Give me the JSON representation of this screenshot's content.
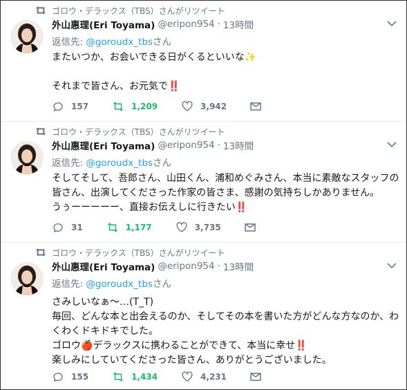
{
  "colors": {
    "name": "#14171a",
    "muted": "#657786",
    "link": "#1da1f2",
    "retweeted": "#17bf63",
    "divider": "#e6ecf0"
  },
  "tweets": [
    {
      "retweet_label": "ゴロウ・デラックス（TBS）さんがリツイート",
      "name": "外山惠理(Eri Toyama)",
      "handle": "@eripon954",
      "dot": "·",
      "time": "13時間",
      "reply_prefix": "返信先: ",
      "reply_to": "@goroudx_tbs",
      "reply_suffix": "さん",
      "lines": [
        "またいつか、お会いできる日がくるといいな✨",
        "",
        "それまで皆さん、お元気で‼️"
      ],
      "replies": "157",
      "retweets": "1,209",
      "likes": "3,942"
    },
    {
      "retweet_label": "ゴロウ・デラックス（TBS）さんがリツイート",
      "name": "外山惠理(Eri Toyama)",
      "handle": "@eripon954",
      "dot": "·",
      "time": "13時間",
      "reply_prefix": "返信先: ",
      "reply_to": "@goroudx_tbs",
      "reply_suffix": "さん",
      "lines": [
        "そしてそして、吾郎さん、山田くん、浦和めぐみさん、本当に素敵なスタッフの",
        "皆さん、出演してくださった作家の皆さま、感謝の気持ちしかありません。",
        "うぅーーーーー、直接お伝えしに行きたい‼️"
      ],
      "replies": "31",
      "retweets": "1,177",
      "likes": "3,735"
    },
    {
      "retweet_label": "ゴロウ・デラックス（TBS）さんがリツイート",
      "name": "外山惠理(Eri Toyama)",
      "handle": "@eripon954",
      "dot": "·",
      "time": "13時間",
      "reply_prefix": "返信先: ",
      "reply_to": "@goroudx_tbs",
      "reply_suffix": "さん",
      "lines": [
        "さみしいなぁ〜…(T_T)",
        "毎回、どんな本と出会えるのか、そしてその本を書いた方がどんな方なのか、わ",
        "くわくドキドキでした。",
        "ゴロウ🍎デラックスに携わることができて、本当に幸せ‼️",
        "楽しみにしていてくださった皆さん、ありがとうございました。"
      ],
      "replies": "155",
      "retweets": "1,434",
      "likes": "4,231"
    }
  ]
}
